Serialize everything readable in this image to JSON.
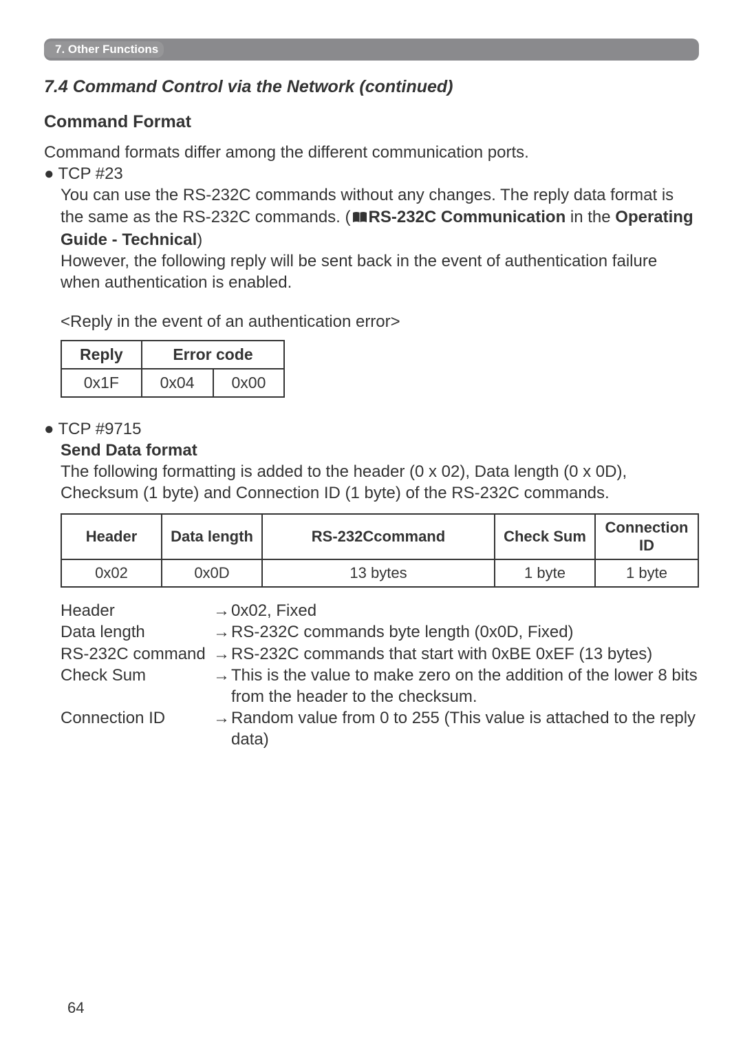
{
  "chapter_label": "7. Other Functions",
  "section_title": "7.4 Command Control via the Network (continued)",
  "sub_heading": "Command Format",
  "intro": "Command formats differ among the different communication ports.",
  "tcp23": {
    "bullet": "TCP #23",
    "p1a": "You can use the RS-232C commands without any changes. The reply data format is the same as the RS-232C commands. (",
    "ref": "RS-232C Communication",
    "p1b": " in the ",
    "guide": "Operating Guide - Technical",
    "p1c": ")",
    "p2": "However, the following reply will be sent back in the event of authentication failure when authentication is enabled.",
    "reply_caption": "<Reply in the event of an authentication error>",
    "table": {
      "h1": "Reply",
      "h2": "Error code",
      "c1": "0x1F",
      "c2": "0x04",
      "c3": "0x00"
    }
  },
  "tcp9715": {
    "bullet": "TCP #9715",
    "heading": "Send Data format",
    "p1": "The following formatting is added to the header (0 x 02), Data length (0 x 0D), Checksum (1 byte) and Connection ID (1 byte) of the RS-232C commands.",
    "table": {
      "h1": "Header",
      "h2": "Data length",
      "h3": "RS-232Ccommand",
      "h4": "Check Sum",
      "h5": "Connection ID",
      "c1": "0x02",
      "c2": "0x0D",
      "c3": "13 bytes",
      "c4": "1 byte",
      "c5": "1 byte"
    },
    "defs": {
      "t1": "Header",
      "d1": "0x02, Fixed",
      "t2": "Data length",
      "d2": "RS-232C commands byte length (0x0D, Fixed)",
      "t3": "RS-232C command",
      "d3": "RS-232C commands that start with 0xBE 0xEF (13 bytes)",
      "t4": "Check Sum",
      "d4": "This is the value to make zero on the addition of the lower 8 bits from the header to the checksum.",
      "t5": "Connection ID",
      "d5": "Random value from 0 to 255 (This value is attached to the reply data)"
    }
  },
  "page_number": "64"
}
